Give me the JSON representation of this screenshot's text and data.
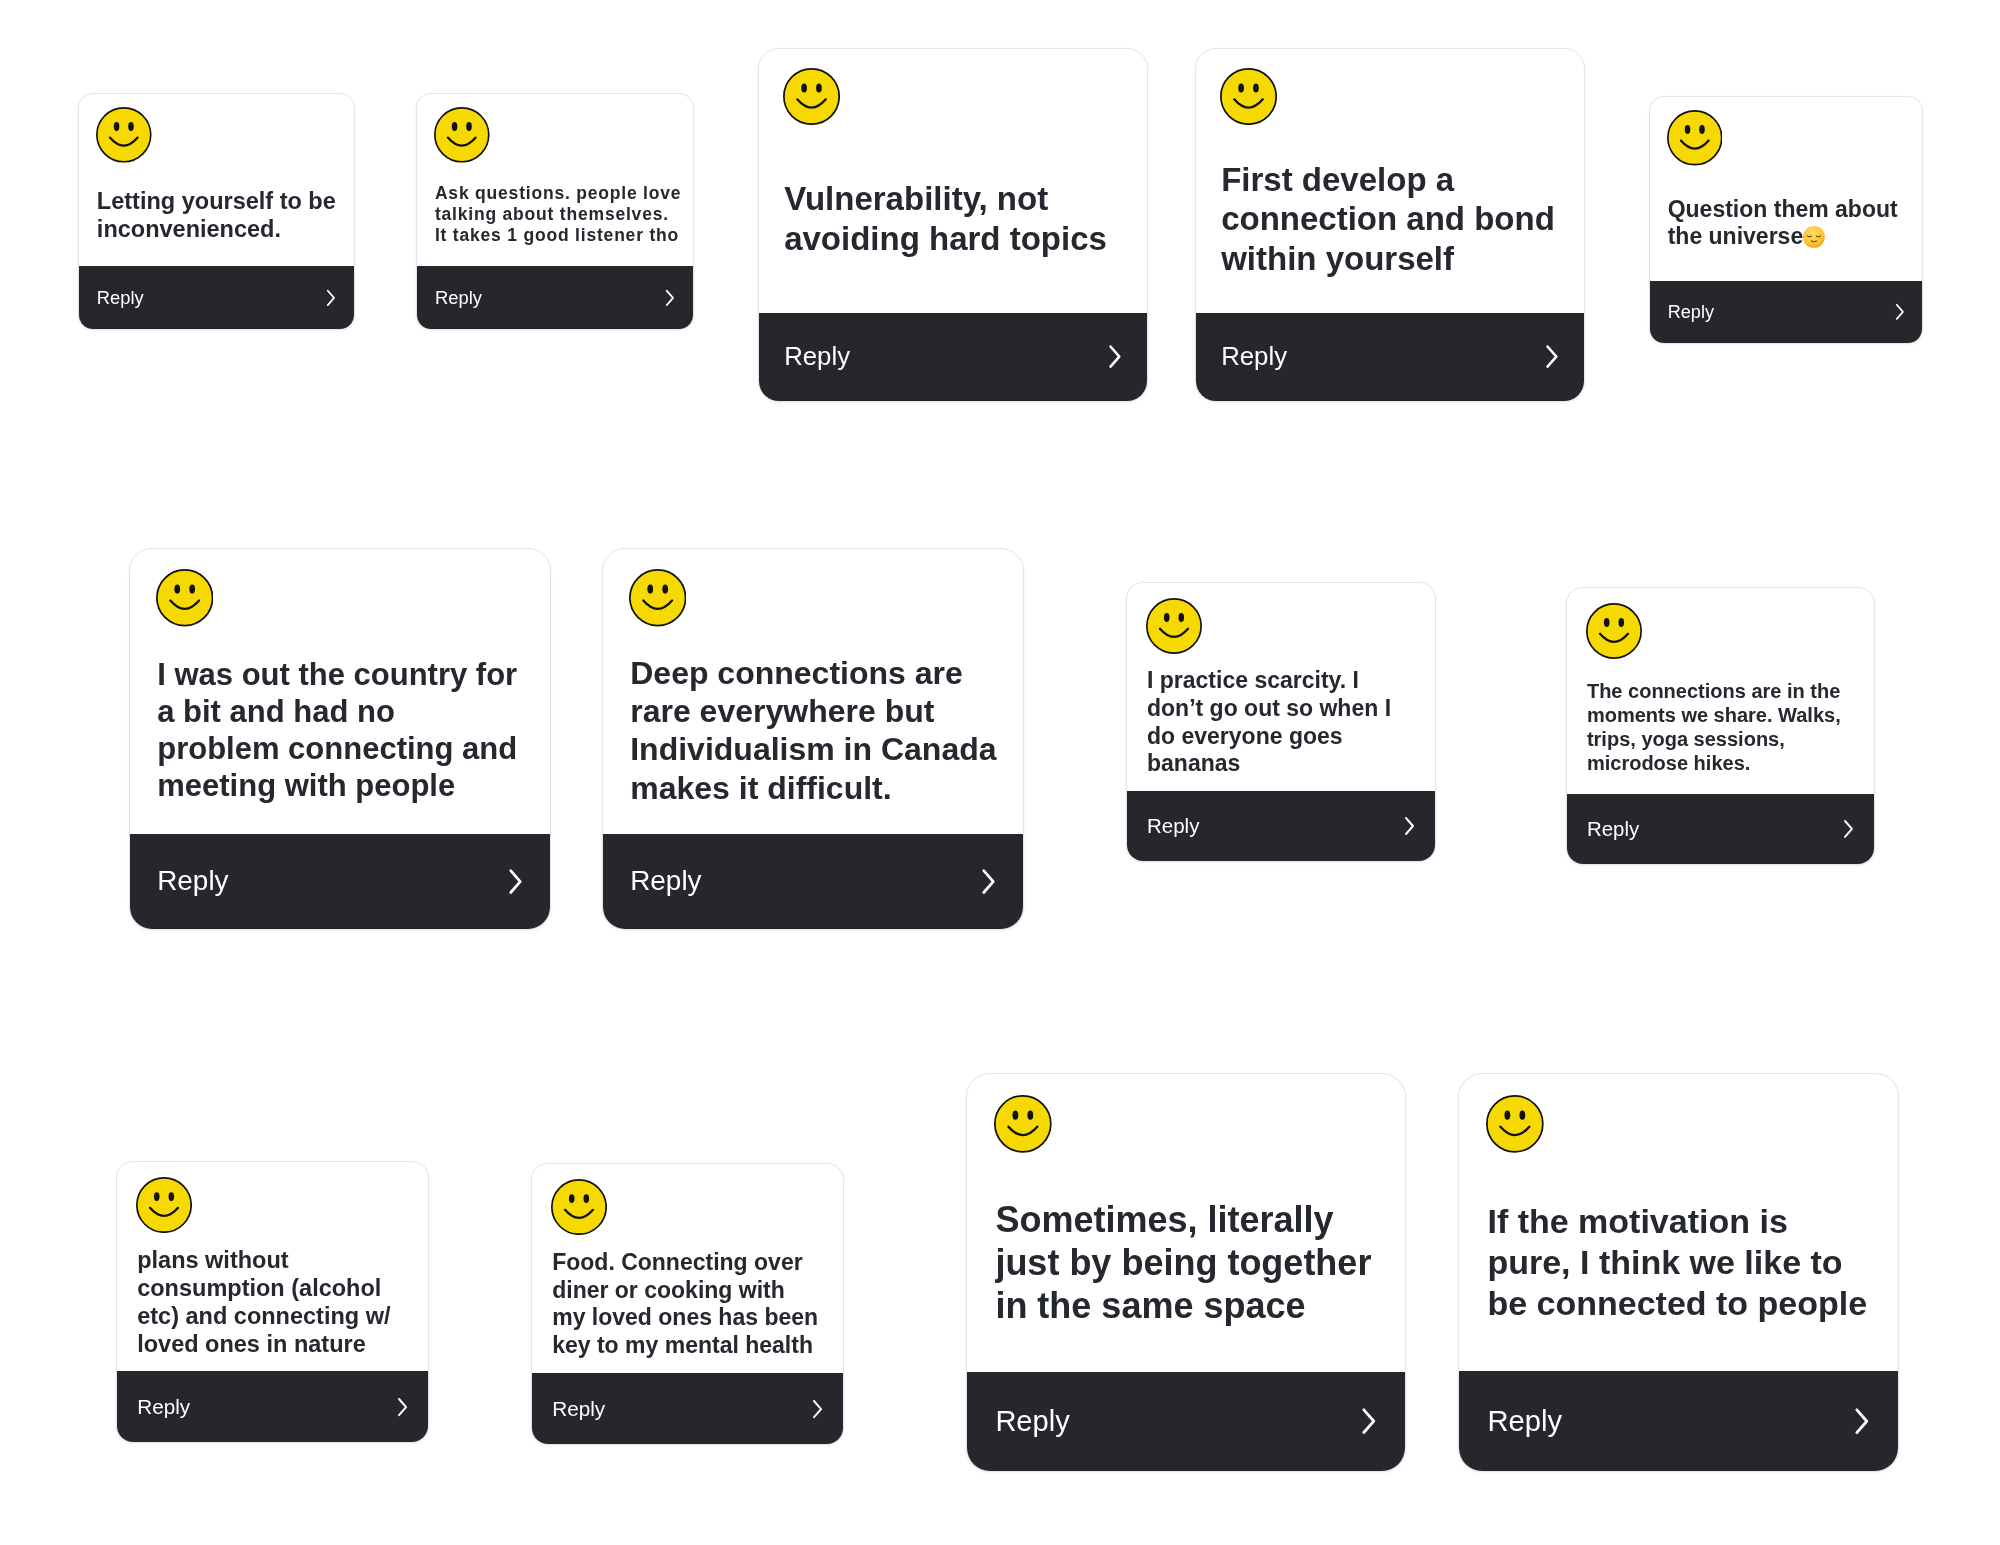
{
  "rows": [
    {
      "cards": [
        {
          "text": "Letting yourself to be inconvenienced.",
          "reply": "Reply"
        },
        {
          "text": "Ask questions. people love talking about themselves. It takes 1 good listener tho",
          "reply": "Reply"
        },
        {
          "text": "Vulnerability, not avoiding hard topics",
          "reply": "Reply"
        },
        {
          "text": "First develop a connection and bond within yourself",
          "reply": "Reply"
        },
        {
          "text": "Question them about the universe",
          "trailing_emoji": true,
          "reply": "Reply"
        }
      ]
    },
    {
      "cards": [
        {
          "text": "I was out the country for a bit and had no problem connecting and meeting with people",
          "reply": "Reply"
        },
        {
          "text": "Deep connections are rare everywhere but Individualism in Canada makes it difficult.",
          "reply": "Reply"
        },
        {
          "text": "I practice scarcity. I don’t go out so when I do everyone goes bananas",
          "reply": "Reply"
        },
        {
          "text": "The connections are in the moments we share. Walks, trips, yoga sessions, microdose hikes.",
          "reply": "Reply"
        }
      ]
    },
    {
      "cards": [
        {
          "text": "plans without consumption (alcohol etc) and connecting w/ loved ones in nature",
          "reply": "Reply"
        },
        {
          "text": "Food. Connecting over diner or cooking with my loved ones has been key to my mental health",
          "reply": "Reply"
        },
        {
          "text": "Sometimes, literally just by being together in the same space",
          "reply": "Reply"
        },
        {
          "text": "If the motivation is pure, I think we like to be connected to people",
          "reply": "Reply"
        }
      ]
    }
  ]
}
